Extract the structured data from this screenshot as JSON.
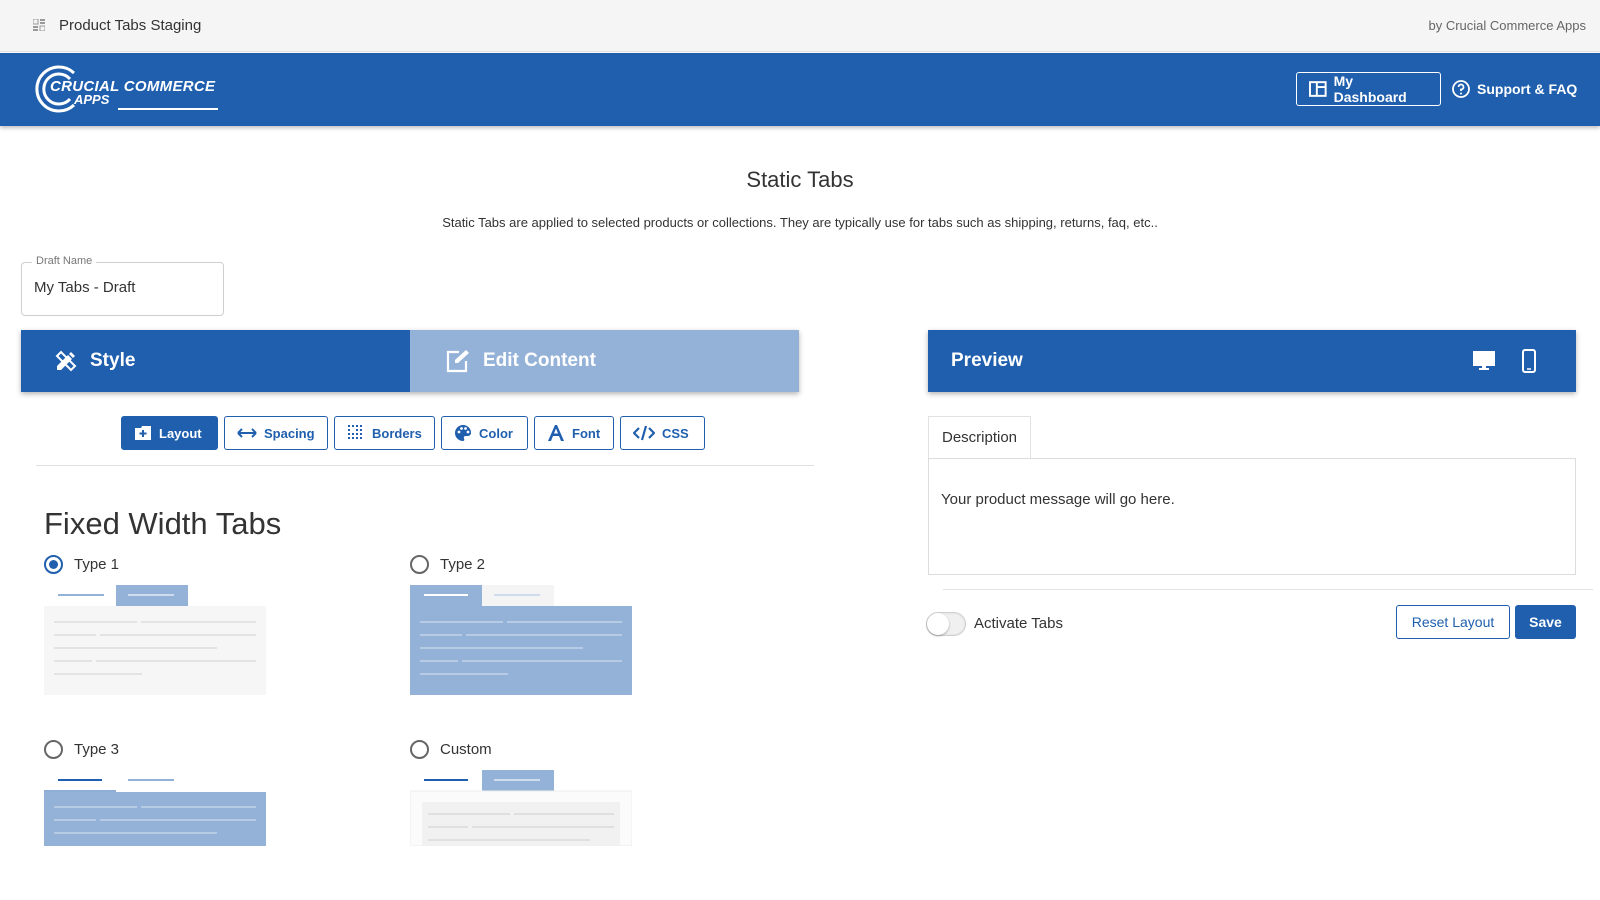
{
  "topbar": {
    "app_name": "Product Tabs Staging",
    "byline": "by Crucial Commerce Apps",
    "icon": "grid-icon"
  },
  "header": {
    "logo_line1": "CRUCIAL COMMERCE",
    "logo_line2": "APPS",
    "dashboard_label": "My Dashboard",
    "support_label": "Support & FAQ",
    "brand_color": "#1f5fad"
  },
  "page": {
    "title": "Static Tabs",
    "subtitle": "Static Tabs are applied to selected products or collections. They are typically use for tabs such as shipping, returns, faq, etc.."
  },
  "draft": {
    "label": "Draft Name",
    "value": "My Tabs - Draft"
  },
  "editor": {
    "tabs": [
      {
        "label": "Style",
        "icon": "pencil-ruler-icon",
        "active": true
      },
      {
        "label": "Edit Content",
        "icon": "edit-icon",
        "active": false
      }
    ],
    "sub_buttons": [
      {
        "label": "Layout",
        "icon": "add-box-icon",
        "active": true
      },
      {
        "label": "Spacing",
        "icon": "arrows-horizontal-icon",
        "active": false
      },
      {
        "label": "Borders",
        "icon": "border-grid-icon",
        "active": false
      },
      {
        "label": "Color",
        "icon": "palette-icon",
        "active": false
      },
      {
        "label": "Font",
        "icon": "font-a-icon",
        "active": false
      },
      {
        "label": "CSS",
        "icon": "code-icon",
        "active": false
      }
    ]
  },
  "layout": {
    "section_title": "Fixed Width Tabs",
    "options": [
      {
        "label": "Type 1",
        "selected": true
      },
      {
        "label": "Type 2",
        "selected": false
      },
      {
        "label": "Type 3",
        "selected": false
      },
      {
        "label": "Custom",
        "selected": false
      }
    ]
  },
  "preview": {
    "title": "Preview",
    "tab_label": "Description",
    "message": "Your product message will go here.",
    "activate_label": "Activate Tabs",
    "activate_on": false,
    "reset_label": "Reset Layout",
    "save_label": "Save"
  }
}
